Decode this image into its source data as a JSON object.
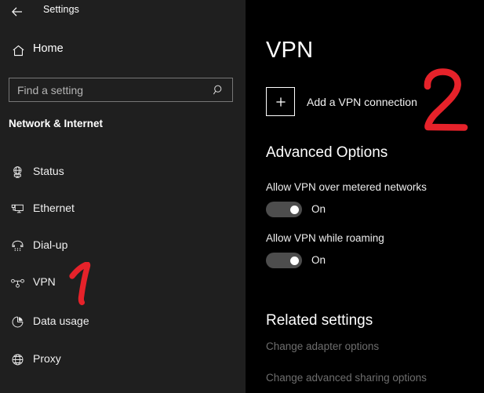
{
  "window": {
    "title": "Settings",
    "back_icon": "back-arrow-icon"
  },
  "sidebar": {
    "home": {
      "label": "Home",
      "icon": "home-icon"
    },
    "search": {
      "placeholder": "Find a setting",
      "value": "",
      "icon": "search-icon"
    },
    "category": "Network & Internet",
    "items": [
      {
        "label": "Status",
        "icon": "status-globe-icon"
      },
      {
        "label": "Ethernet",
        "icon": "ethernet-icon"
      },
      {
        "label": "Dial-up",
        "icon": "dialup-phone-icon"
      },
      {
        "label": "VPN",
        "icon": "vpn-nodes-icon"
      },
      {
        "label": "Data usage",
        "icon": "pie-chart-icon"
      },
      {
        "label": "Proxy",
        "icon": "globe-icon"
      }
    ]
  },
  "main": {
    "heading": "VPN",
    "add_connection": {
      "label": "Add a VPN connection",
      "icon": "plus-icon"
    },
    "advanced_heading": "Advanced Options",
    "settings": [
      {
        "label": "Allow VPN over metered networks",
        "state": "On",
        "enabled": true
      },
      {
        "label": "Allow VPN while roaming",
        "state": "On",
        "enabled": true
      }
    ],
    "related_heading": "Related settings",
    "related_links": [
      {
        "label": "Change adapter options"
      },
      {
        "label": "Change advanced sharing options"
      }
    ]
  },
  "annotations": [
    {
      "text": "1",
      "color": "#e6222a",
      "target": "sidebar-item-vpn"
    },
    {
      "text": "2",
      "color": "#e6222a",
      "target": "add-vpn-connection-button"
    }
  ],
  "colors": {
    "sidebar_bg": "#1f1f1f",
    "main_bg": "#000000",
    "annotation_red": "#e6222a",
    "toggle_track": "#4d4d4d"
  }
}
